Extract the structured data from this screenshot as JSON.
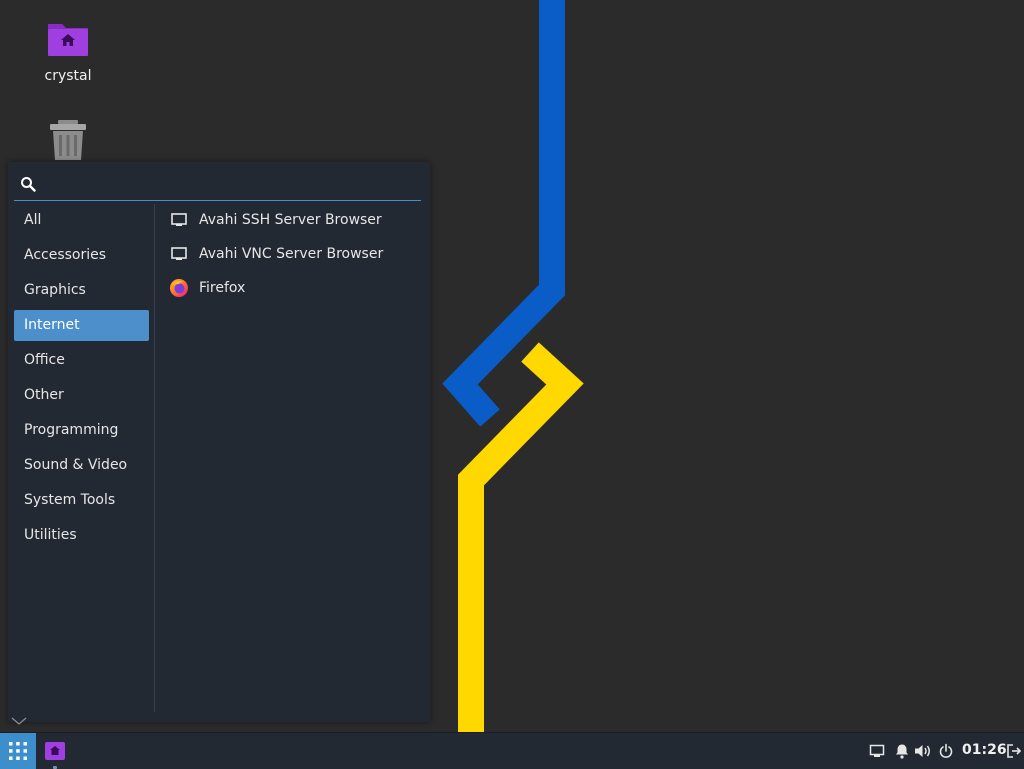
{
  "desktop": {
    "icons": [
      {
        "label": "crystal",
        "icon": "home-folder-icon"
      },
      {
        "label": "",
        "icon": "trash-icon"
      }
    ],
    "wallpaper_colors": {
      "blue": "#0a5cc6",
      "yellow": "#ffd800",
      "background": "#2b2b2b"
    }
  },
  "menu": {
    "search": {
      "value": "",
      "placeholder": "",
      "icon": "search-icon"
    },
    "categories": [
      {
        "label": "All",
        "selected": false
      },
      {
        "label": "Accessories",
        "selected": false
      },
      {
        "label": "Graphics",
        "selected": false
      },
      {
        "label": "Internet",
        "selected": true
      },
      {
        "label": "Office",
        "selected": false
      },
      {
        "label": "Other",
        "selected": false
      },
      {
        "label": "Programming",
        "selected": false
      },
      {
        "label": "Sound & Video",
        "selected": false
      },
      {
        "label": "System Tools",
        "selected": false
      },
      {
        "label": "Utilities",
        "selected": false
      }
    ],
    "apps": [
      {
        "label": "Avahi SSH Server Browser",
        "icon": "monitor-icon"
      },
      {
        "label": "Avahi VNC Server Browser",
        "icon": "monitor-icon"
      },
      {
        "label": "Firefox",
        "icon": "firefox-icon"
      }
    ],
    "accent": "#4d8fcb"
  },
  "taskbar": {
    "menu_button_icon": "app-grid-icon",
    "task_icon": "home-folder-icon",
    "tray": [
      "display-icon",
      "notification-bell-icon",
      "volume-icon",
      "power-icon",
      "logout-icon"
    ],
    "clock": "01:26"
  }
}
